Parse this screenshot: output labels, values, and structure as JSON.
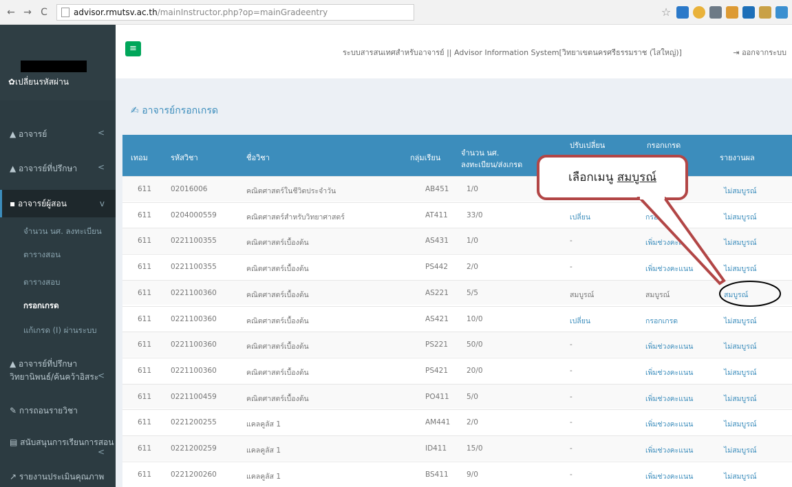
{
  "browser": {
    "url_host": "advisor.rmutsv.ac.th",
    "url_path": "/mainInstructor.php?op=mainGradeentry"
  },
  "sidebar": {
    "change_password": "✿เปลี่ยนรหัสผ่าน",
    "menu": [
      {
        "label": "อาจารย์",
        "caret": "<"
      },
      {
        "label": "อาจารย์ที่ปรึกษา",
        "caret": "<"
      },
      {
        "label": "อาจารย์ผู้สอน",
        "caret": "v"
      },
      {
        "label": "อาจารย์ที่ปรึกษา",
        "label2": "วิทยานิพนธ์/ค้นคว้าอิสระ",
        "caret": "<"
      },
      {
        "label": "การถอนรายวิชา"
      },
      {
        "label": "สนับสนุนการเรียนการสอน",
        "caret": "<"
      },
      {
        "label": "รายงานประเมินคุณภาพ"
      }
    ],
    "submenu": [
      "จำนวน นศ. ลงทะเบียน",
      "ตารางสอน",
      "ตารางสอบ",
      "กรอกเกรด",
      "แก้เกรด (I) ผ่านระบบ"
    ]
  },
  "header": {
    "system_title": "ระบบสารสนเทศสำหรับอาจารย์ || Advisor Information System[วิทยาเขตนครศรีธรรมราช (ไสใหญ่)]",
    "logout": "ออกจากระบบ"
  },
  "page_title": "อาจารย์กรอกเกรด",
  "table": {
    "headers": [
      "เทอม",
      "รหัสวิชา",
      "ชื่อวิชา",
      "กลุ่มเรียน",
      "จำนวน นศ.",
      "ลงทะเบียน/ส่งเกรด",
      "ปรับเปลี่ยน",
      "กรอกเกรด",
      "รายงานผล"
    ],
    "rows": [
      [
        "611",
        "02016006",
        "คณิตศาสตร์ในชีวิตประจำวัน",
        "AB451",
        "1/0",
        "",
        "",
        "ไม่สมบูรณ์"
      ],
      [
        "611",
        "0204000559",
        "คณิตศาสตร์สำหรับวิทยาศาสตร์",
        "AT411",
        "33/0",
        "เปลี่ยน",
        "กรอกเกรด",
        "ไม่สมบูรณ์"
      ],
      [
        "611",
        "0221100355",
        "คณิตศาสตร์เบื้องต้น",
        "AS431",
        "1/0",
        "-",
        "เพิ่มช่วงคะแนน",
        "ไม่สมบูรณ์"
      ],
      [
        "611",
        "0221100355",
        "คณิตศาสตร์เบื้องต้น",
        "PS442",
        "2/0",
        "-",
        "เพิ่มช่วงคะแนน",
        "ไม่สมบูรณ์"
      ],
      [
        "611",
        "0221100360",
        "คณิตศาสตร์เบื้องต้น",
        "AS221",
        "5/5",
        "สมบูรณ์",
        "สมบูรณ์",
        "สมบูรณ์"
      ],
      [
        "611",
        "0221100360",
        "คณิตศาสตร์เบื้องต้น",
        "AS421",
        "10/0",
        "เปลี่ยน",
        "กรอกเกรด",
        "ไม่สมบูรณ์"
      ],
      [
        "611",
        "0221100360",
        "คณิตศาสตร์เบื้องต้น",
        "PS221",
        "50/0",
        "-",
        "เพิ่มช่วงคะแนน",
        "ไม่สมบูรณ์"
      ],
      [
        "611",
        "0221100360",
        "คณิตศาสตร์เบื้องต้น",
        "PS421",
        "20/0",
        "-",
        "เพิ่มช่วงคะแนน",
        "ไม่สมบูรณ์"
      ],
      [
        "611",
        "0221100459",
        "คณิตศาสตร์เบื้องต้น",
        "PO411",
        "5/0",
        "-",
        "เพิ่มช่วงคะแนน",
        "ไม่สมบูรณ์"
      ],
      [
        "611",
        "0221200255",
        "แคลคูลัส 1",
        "AM441",
        "2/0",
        "-",
        "เพิ่มช่วงคะแนน",
        "ไม่สมบูรณ์"
      ],
      [
        "611",
        "0221200259",
        "แคลคูลัส 1",
        "ID411",
        "15/0",
        "-",
        "เพิ่มช่วงคะแนน",
        "ไม่สมบูรณ์"
      ],
      [
        "611",
        "0221200260",
        "แคลคูลัส 1",
        "BS411",
        "9/0",
        "-",
        "เพิ่มช่วงคะแนน",
        "ไม่สมบูรณ์"
      ]
    ]
  },
  "callout": {
    "prefix": "เลือกเมนู ",
    "highlight": "สมบูรณ์"
  },
  "colors": {
    "accent": "#3c8dbc",
    "sidebar": "#2c3b41",
    "annotation": "#b24646"
  }
}
